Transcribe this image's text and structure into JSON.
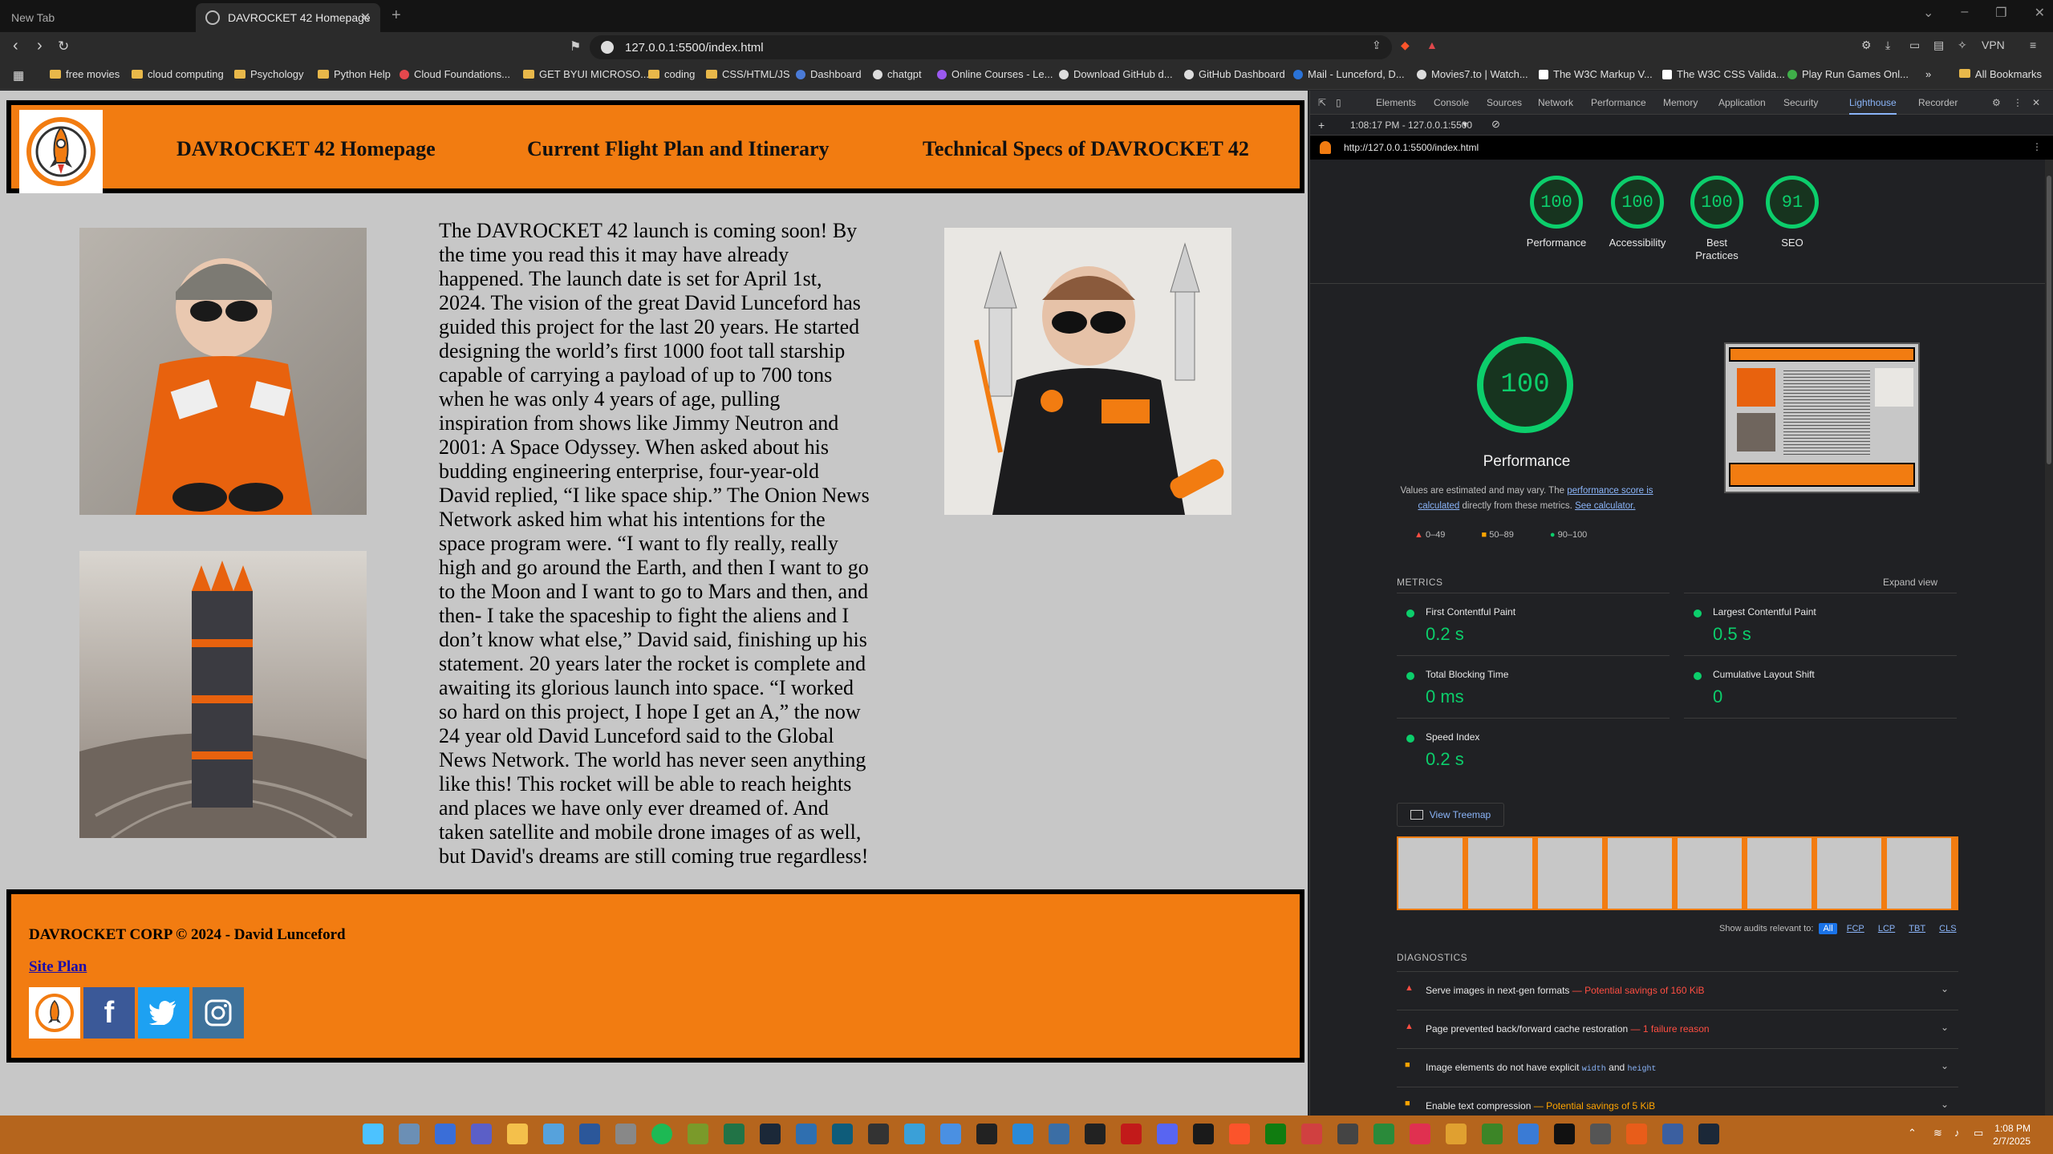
{
  "browser": {
    "tabs": [
      {
        "label": "New Tab",
        "active": false
      },
      {
        "label": "DAVROCKET 42 Homepage",
        "active": true
      }
    ],
    "url": "127.0.0.1:5500/index.html",
    "vpn_label": "VPN",
    "bookmarks": [
      {
        "label": "free movies",
        "icon": "folder-icon"
      },
      {
        "label": "cloud computing",
        "icon": "folder-icon"
      },
      {
        "label": "Psychology",
        "icon": "folder-icon"
      },
      {
        "label": "Python Help",
        "icon": "folder-icon"
      },
      {
        "label": "Cloud Foundations...",
        "icon": "site-icon"
      },
      {
        "label": "GET BYUI MICROSO...",
        "icon": "folder-icon"
      },
      {
        "label": "coding",
        "icon": "folder-icon"
      },
      {
        "label": "CSS/HTML/JS",
        "icon": "folder-icon"
      },
      {
        "label": "Dashboard",
        "icon": "site-icon"
      },
      {
        "label": "chatgpt",
        "icon": "site-icon"
      },
      {
        "label": "Online Courses - Le...",
        "icon": "site-icon"
      },
      {
        "label": "Download GitHub d...",
        "icon": "site-icon"
      },
      {
        "label": "GitHub Dashboard",
        "icon": "github-icon"
      },
      {
        "label": "Mail - Lunceford, D...",
        "icon": "site-icon"
      },
      {
        "label": "Movies7.to | Watch...",
        "icon": "site-icon"
      },
      {
        "label": "The W3C Markup V...",
        "icon": "site-icon"
      },
      {
        "label": "The W3C CSS Valida...",
        "icon": "site-icon"
      },
      {
        "label": "Play Run Games Onl...",
        "icon": "site-icon"
      }
    ],
    "all_bookmarks": "All Bookmarks"
  },
  "site": {
    "nav": [
      "DAVROCKET 42 Homepage",
      "Current Flight Plan and Itinerary",
      "Technical Specs of DAVROCKET 42"
    ],
    "article": "The DAVROCKET 42 launch is coming soon! By the time you read this it may have already happened. The launch date is set for April 1st, 2024. The vision of the great David Lunceford has guided this project for the last 20 years. He started designing the world’s first 1000 foot tall starship capable of carrying a payload of up to 700 tons when he was only 4 years of age, pulling inspiration from shows like Jimmy Neutron and 2001: A Space Odyssey. When asked about his budding engineering enterprise, four-year-old David replied, “I like space ship.” The Onion News Network asked him what his intentions for the space program were. “I want to fly really, really high and go around the Earth, and then I want to go to the Moon and I want to go to Mars and then, and then- I take the spaceship to fight the aliens and I don’t know what else,” David said, finishing up his statement. 20 years later the rocket is complete and awaiting its glorious launch into space. “I worked so hard on this project, I hope I get an A,” the now 24 year old David Lunceford said to the Global News Network. The world has never seen anything like this! This rocket will be able to reach heights and places we have only ever dreamed of. And taken satellite and mobile drone images of as well, but David's dreams are still coming true regardless!",
    "footer": {
      "corp": "DAVROCKET CORP © 2024 - David Lunceford",
      "site_plan": "Site Plan",
      "socials": [
        "rocket-logo-icon",
        "facebook-icon",
        "twitter-icon",
        "instagram-icon"
      ]
    },
    "colors": {
      "orange": "#f27c11",
      "page_bg": "#c7c7c7"
    }
  },
  "devtools": {
    "tabs": [
      "Elements",
      "Console",
      "Sources",
      "Network",
      "Performance",
      "Memory",
      "Application",
      "Security",
      "Lighthouse",
      "Recorder"
    ],
    "selected_tab": "Lighthouse",
    "report_time": "1:08:17 PM - 127.0.0.1:5500",
    "report_url": "http://127.0.0.1:5500/index.html",
    "scores": [
      {
        "label": "Performance",
        "value": "100"
      },
      {
        "label": "Accessibility",
        "value": "100"
      },
      {
        "label": "Best Practices",
        "value": "100"
      },
      {
        "label": "SEO",
        "value": "91"
      }
    ],
    "big_score": "100",
    "perf_title": "Performance",
    "perf_note_1": "Values are estimated and may vary. The ",
    "perf_note_link1": "performance score is calculated",
    "perf_note_2": " directly from these metrics. ",
    "perf_note_link2": "See calculator.",
    "legend": [
      "0–49",
      "50–89",
      "90–100"
    ],
    "metrics_title": "METRICS",
    "expand_view": "Expand view",
    "metrics": [
      {
        "label": "First Contentful Paint",
        "value": "0.2 s"
      },
      {
        "label": "Largest Contentful Paint",
        "value": "0.5 s"
      },
      {
        "label": "Total Blocking Time",
        "value": "0 ms"
      },
      {
        "label": "Cumulative Layout Shift",
        "value": "0"
      },
      {
        "label": "Speed Index",
        "value": "0.2 s"
      }
    ],
    "treemap": "View Treemap",
    "audits_relevant": "Show audits relevant to:",
    "audit_chips": [
      "All",
      "FCP",
      "LCP",
      "TBT",
      "CLS"
    ],
    "diagnostics_title": "DIAGNOSTICS",
    "diagnostics": [
      {
        "text": "Serve images in next-gen formats",
        "detail": "— Potential savings of 160 KiB",
        "severity": "red"
      },
      {
        "text": "Page prevented back/forward cache restoration",
        "detail": "— 1 failure reason",
        "severity": "red"
      },
      {
        "text": "Image elements do not have explicit",
        "code1": "width",
        "and": "and",
        "code2": "height",
        "severity": "orange"
      },
      {
        "text": "Enable text compression",
        "detail": "— Potential savings of 5 KiB",
        "severity": "orange"
      }
    ]
  },
  "taskbar": {
    "time": "1:08 PM",
    "date": "2/7/2025"
  }
}
